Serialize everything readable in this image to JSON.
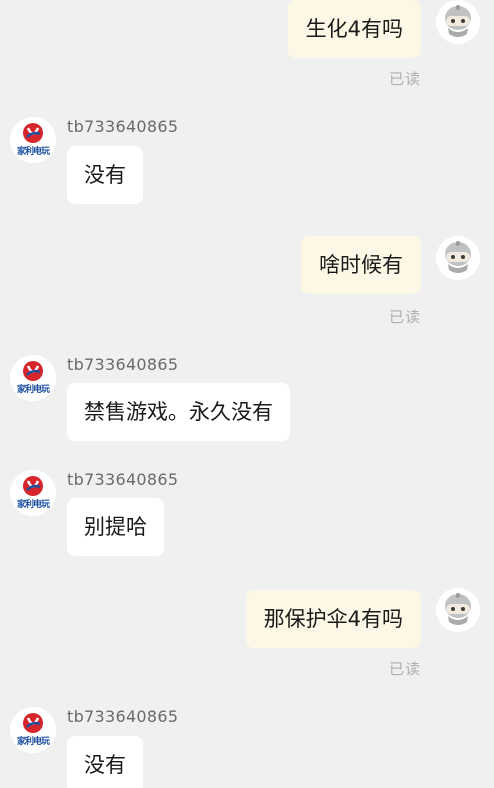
{
  "conversation": {
    "messages": [
      {
        "direction": "outgoing",
        "text": "生化4有吗",
        "status": "已读"
      },
      {
        "direction": "incoming",
        "sender": "tb733640865",
        "text": "没有"
      },
      {
        "direction": "outgoing",
        "text": "啥时候有",
        "status": "已读"
      },
      {
        "direction": "incoming",
        "sender": "tb733640865",
        "text": "禁售游戏。永久没有"
      },
      {
        "direction": "incoming",
        "sender": "tb733640865",
        "text": "别提哈"
      },
      {
        "direction": "outgoing",
        "text": "那保护伞4有吗",
        "status": "已读"
      },
      {
        "direction": "incoming",
        "sender": "tb733640865",
        "text": "没有"
      }
    ],
    "shop_logo_text": "家利电玩",
    "colors": {
      "background": "#f0f0f0",
      "outgoing_bubble": "#fdf8e6",
      "incoming_bubble": "#ffffff",
      "logo_red": "#d6262b",
      "logo_blue": "#1c4fa0"
    },
    "icons": {
      "user_avatar": "robot-avatar-icon",
      "shop_avatar": "shop-logo-icon"
    }
  }
}
